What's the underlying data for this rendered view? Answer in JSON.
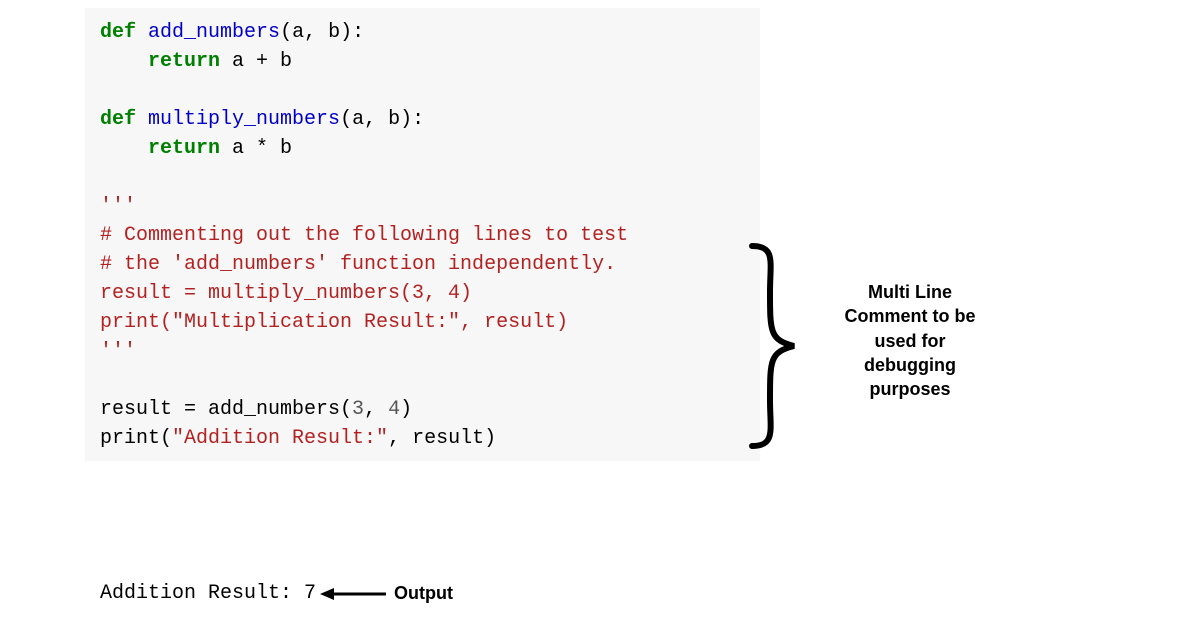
{
  "code": {
    "def1": "def",
    "fn1": "add_numbers",
    "params1": "(a, b):",
    "return1": "return",
    "expr1": " a + b",
    "def2": "def",
    "fn2": "multiply_numbers",
    "params2": "(a, b):",
    "return2": "return",
    "expr2": " a * b",
    "triple_open": "'''",
    "comment1": "# Commenting out the following lines to test",
    "comment2": "# the 'add_numbers' function independently.",
    "line_mul": "result = multiply_numbers(3, 4)",
    "print_mul_a": "print(",
    "print_mul_str": "\"Multiplication Result:\"",
    "print_mul_b": ", result)",
    "triple_close": "'''",
    "line_add_a": "result = add_numbers(",
    "line_add_args": "3",
    "line_add_comma": ", ",
    "line_add_args2": "4",
    "line_add_close": ")",
    "print_add_a": "print(",
    "print_add_str": "\"Addition Result:\"",
    "print_add_b": ", result)"
  },
  "output": {
    "text": "Addition Result: 7",
    "label": "Output"
  },
  "annotation": {
    "l1": "Multi Line",
    "l2": "Comment to be",
    "l3": "used for",
    "l4": "debugging",
    "l5": "purposes"
  }
}
